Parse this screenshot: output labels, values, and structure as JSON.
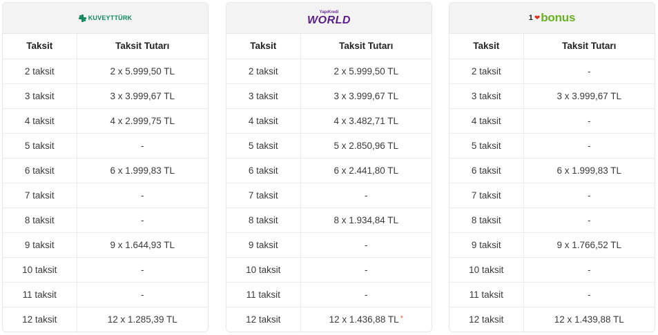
{
  "cards": [
    {
      "logo": {
        "icon": "kuveyt-turk-logo",
        "text": "KUVEYTTÜRK",
        "color": "#0f8a5f"
      },
      "headers": {
        "col1": "Taksit",
        "col2": "Taksit Tutarı"
      },
      "rows": [
        {
          "count": "2 taksit",
          "amount": "2 x 5.999,50 TL"
        },
        {
          "count": "3 taksit",
          "amount": "3 x 3.999,67 TL"
        },
        {
          "count": "4 taksit",
          "amount": "4 x 2.999,75 TL"
        },
        {
          "count": "5 taksit",
          "amount": "-"
        },
        {
          "count": "6 taksit",
          "amount": "6 x 1.999,83 TL"
        },
        {
          "count": "7 taksit",
          "amount": "-"
        },
        {
          "count": "8 taksit",
          "amount": "-"
        },
        {
          "count": "9 taksit",
          "amount": "9 x 1.644,93 TL"
        },
        {
          "count": "10 taksit",
          "amount": "-"
        },
        {
          "count": "11 taksit",
          "amount": "-"
        },
        {
          "count": "12 taksit",
          "amount": "12 x 1.285,39 TL"
        }
      ]
    },
    {
      "logo": {
        "icon": "world-logo",
        "top_text": "YapıKredi",
        "text": "WORLD",
        "color": "#5a1f87"
      },
      "headers": {
        "col1": "Taksit",
        "col2": "Taksit Tutarı"
      },
      "rows": [
        {
          "count": "2 taksit",
          "amount": "2 x 5.999,50 TL"
        },
        {
          "count": "3 taksit",
          "amount": "3 x 3.999,67 TL"
        },
        {
          "count": "4 taksit",
          "amount": "4 x 3.482,71 TL"
        },
        {
          "count": "5 taksit",
          "amount": "5 x 2.850,96 TL"
        },
        {
          "count": "6 taksit",
          "amount": "6 x 2.441,80 TL"
        },
        {
          "count": "7 taksit",
          "amount": "-"
        },
        {
          "count": "8 taksit",
          "amount": "8 x 1.934,84 TL"
        },
        {
          "count": "9 taksit",
          "amount": "-"
        },
        {
          "count": "10 taksit",
          "amount": "-"
        },
        {
          "count": "11 taksit",
          "amount": "-"
        },
        {
          "count": "12 taksit",
          "amount": "12 x 1.436,88 TL",
          "note": "*"
        }
      ]
    },
    {
      "logo": {
        "icon": "bonus-logo",
        "text": "bonus",
        "prefix": "1",
        "color": "#6ab023"
      },
      "headers": {
        "col1": "Taksit",
        "col2": "Taksit Tutarı"
      },
      "rows": [
        {
          "count": "2 taksit",
          "amount": "-"
        },
        {
          "count": "3 taksit",
          "amount": "3 x 3.999,67 TL"
        },
        {
          "count": "4 taksit",
          "amount": "-"
        },
        {
          "count": "5 taksit",
          "amount": "-"
        },
        {
          "count": "6 taksit",
          "amount": "6 x 1.999,83 TL"
        },
        {
          "count": "7 taksit",
          "amount": "-"
        },
        {
          "count": "8 taksit",
          "amount": "-"
        },
        {
          "count": "9 taksit",
          "amount": "9 x 1.766,52 TL"
        },
        {
          "count": "10 taksit",
          "amount": "-"
        },
        {
          "count": "11 taksit",
          "amount": "-"
        },
        {
          "count": "12 taksit",
          "amount": "12 x 1.439,88 TL"
        }
      ]
    }
  ]
}
